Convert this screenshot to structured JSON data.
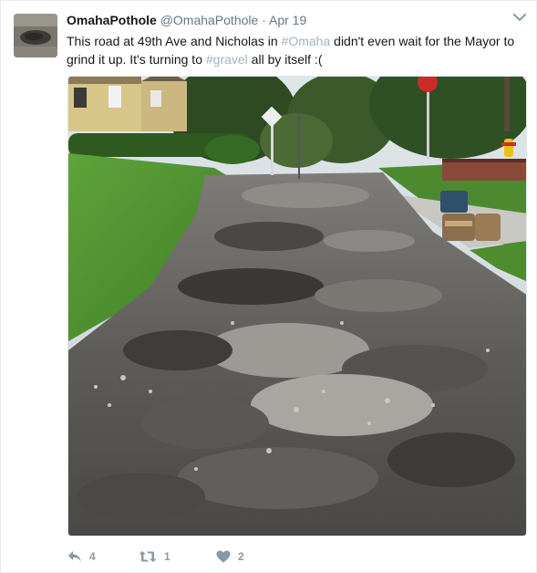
{
  "tweet": {
    "display_name": "OmahaPothole",
    "handle": "@OmahaPothole",
    "separator": "·",
    "time": "Apr 19",
    "text_part1": "This road at 49th Ave and Nicholas in ",
    "hashtag1": "#Omaha",
    "text_part2": " didn't even wait for the Mayor to grind it up. It's turning to ",
    "hashtag2": "#gravel",
    "text_part3": " all by itself :(",
    "hashtag_color": "#9fb3c4",
    "media_description_icon": "photo"
  },
  "actions": {
    "reply_count": "4",
    "retweet_count": "1",
    "like_count": "2",
    "icon_color": "#8899a6"
  }
}
